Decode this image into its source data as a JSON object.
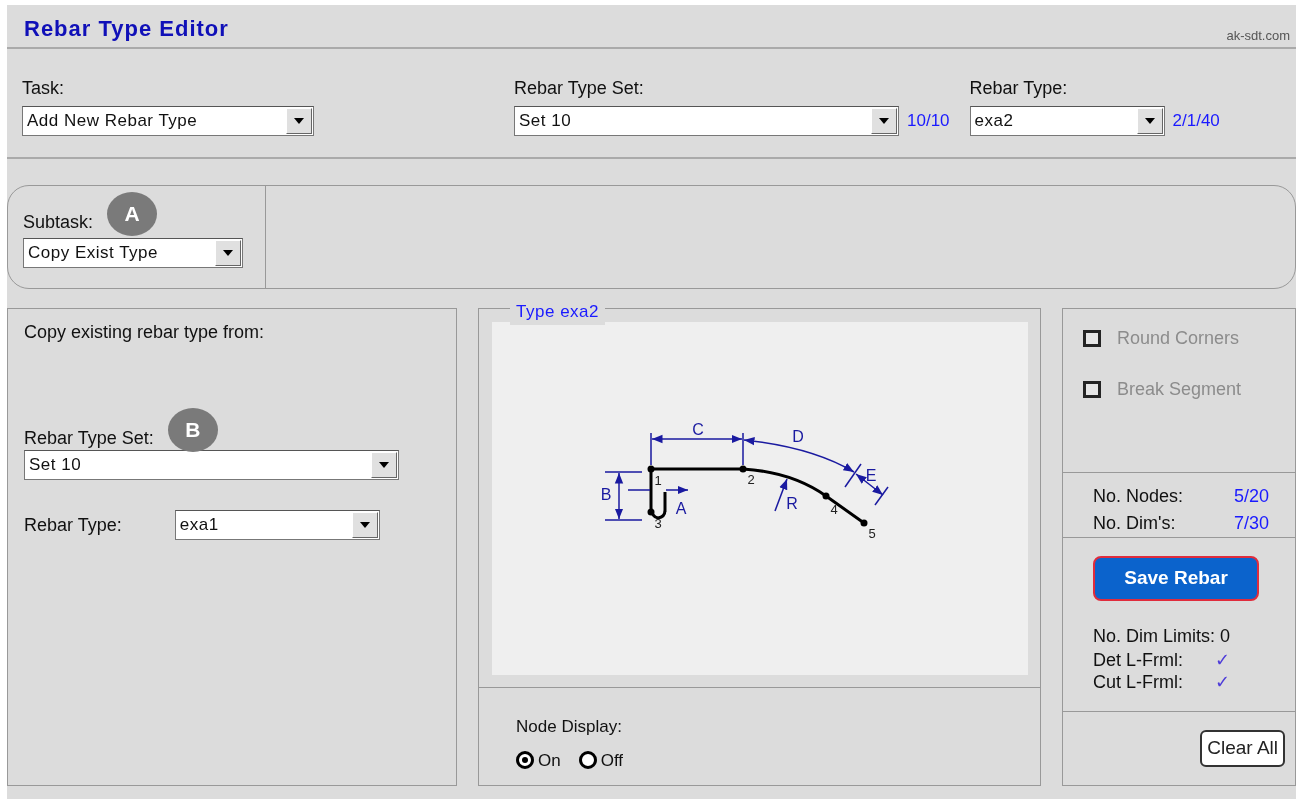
{
  "header": {
    "title": "Rebar Type Editor",
    "site": "ak-sdt.com"
  },
  "task_row": [
    {
      "label": "Task:",
      "value": "Add New Rebar Type"
    },
    {
      "label": "Rebar Type Set:",
      "value": "Set 10",
      "count": "10/10"
    },
    {
      "label": "Rebar Type:",
      "value": "exa2",
      "count": "2/1/40"
    }
  ],
  "subtask": {
    "label": "Subtask:",
    "marker": "A",
    "value": "Copy Exist Type"
  },
  "copy_panel": {
    "heading": "Copy existing rebar type from:",
    "set_label": "Rebar Type Set:",
    "marker": "B",
    "set_value": "Set 10",
    "type_label": "Rebar Type:",
    "type_value": "exa1"
  },
  "preview": {
    "legend": "Type exa2",
    "dimension_labels": [
      "C",
      "D",
      "E",
      "B",
      "A",
      "R"
    ],
    "node_labels": [
      "1",
      "2",
      "3",
      "4",
      "5"
    ],
    "node_display": {
      "label": "Node Display:",
      "options": [
        {
          "label": "On",
          "selected": true
        },
        {
          "label": "Off",
          "selected": false
        }
      ]
    }
  },
  "options": [
    {
      "label": "Round Corners",
      "checked": false,
      "disabled": true
    },
    {
      "label": "Break Segment",
      "checked": false,
      "disabled": true
    }
  ],
  "counts": [
    {
      "label": "No. Nodes:",
      "value": "5/20"
    },
    {
      "label": "No. Dim's:",
      "value": "7/30"
    }
  ],
  "save_button": "Save Rebar",
  "limits": {
    "label": "No. Dim Limits: 0",
    "rows": [
      {
        "label": "Det L-Frml:",
        "mark": "✓"
      },
      {
        "label": "Cut L-Frml:",
        "mark": "✓"
      }
    ]
  },
  "clear_button": "Clear All"
}
